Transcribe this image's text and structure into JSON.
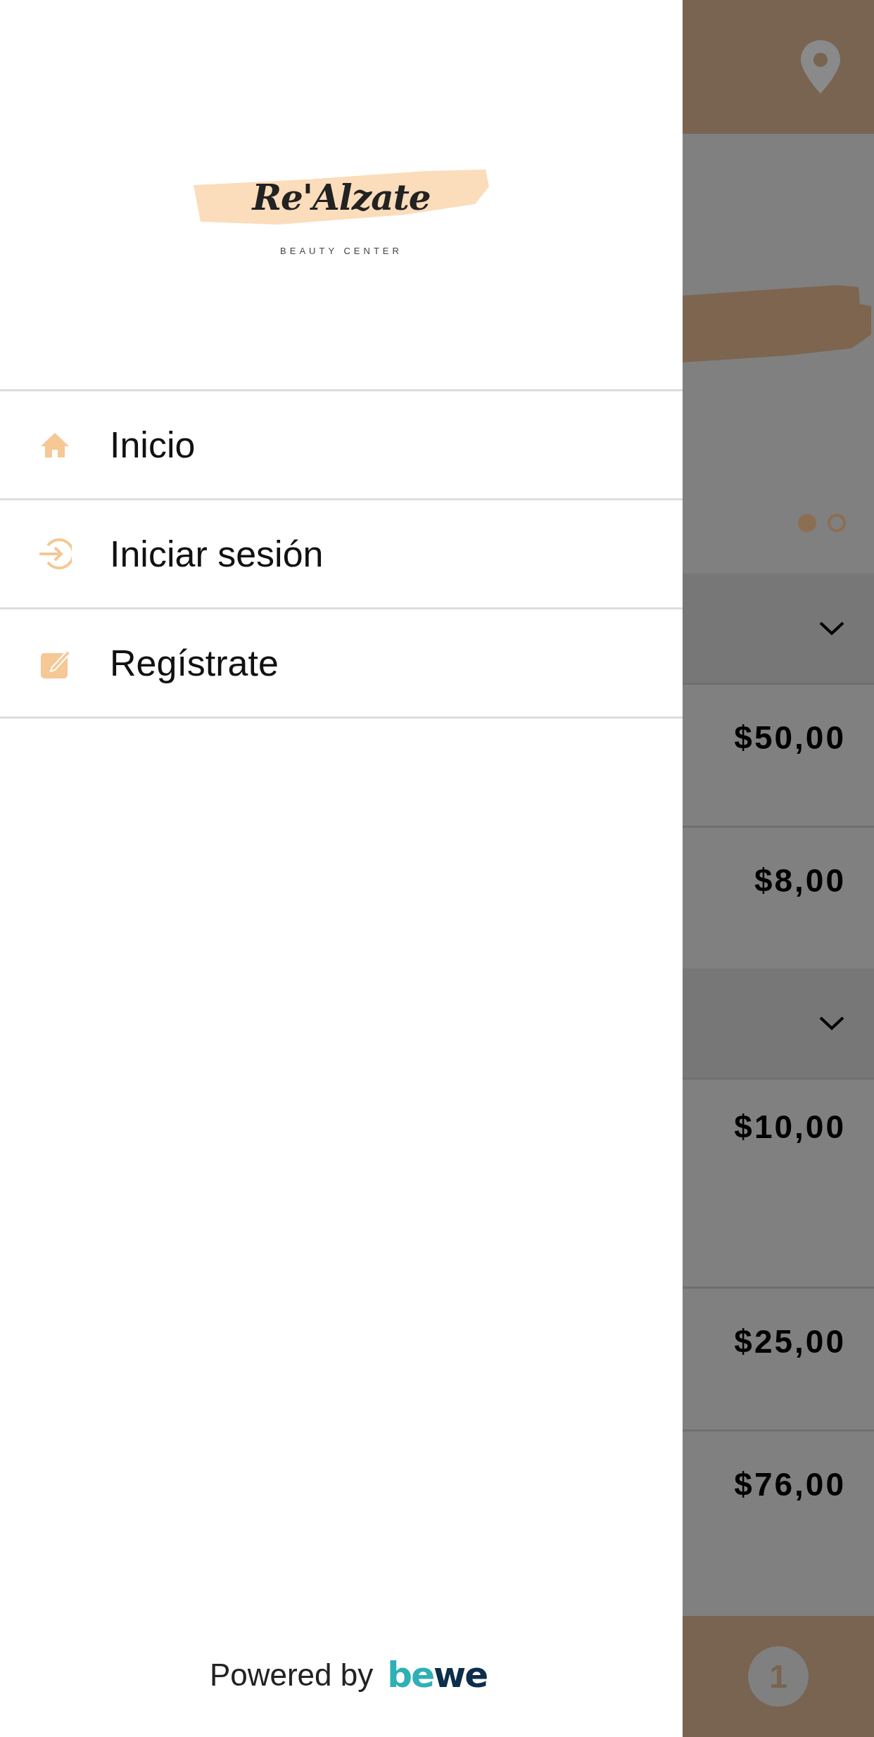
{
  "drawer": {
    "logo": {
      "name": "Re'Alzate",
      "tagline": "BEAUTY CENTER"
    },
    "menu": [
      {
        "label": "Inicio"
      },
      {
        "label": "Iniciar sesión"
      },
      {
        "label": "Regístrate"
      }
    ],
    "footer": {
      "text": "Powered by",
      "brand": "bewe"
    }
  },
  "background": {
    "slides": [
      {
        "selected": true
      },
      {
        "selected": false
      }
    ],
    "rows": [
      {
        "kind": "section",
        "expanded": false
      },
      {
        "kind": "price",
        "price": "$50,00"
      },
      {
        "kind": "price",
        "price": "$8,00"
      },
      {
        "kind": "section",
        "expanded": false
      },
      {
        "kind": "price",
        "price": "$10,00"
      },
      {
        "kind": "price",
        "price": "$25,00"
      },
      {
        "kind": "price",
        "price": "$76,00"
      }
    ],
    "cart_count": "1"
  }
}
